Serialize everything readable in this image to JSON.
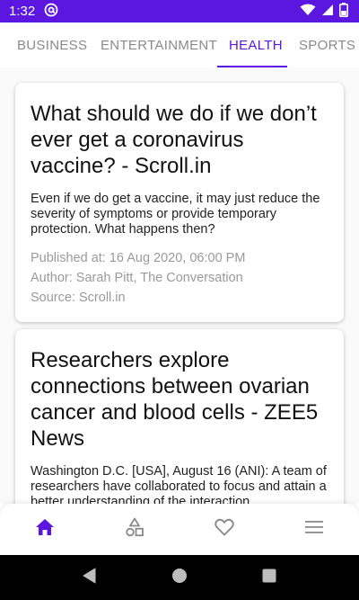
{
  "status_bar": {
    "time": "1:32",
    "icons": [
      "at-sign-icon",
      "wifi-icon",
      "signal-icon",
      "battery-icon"
    ]
  },
  "tabs": [
    {
      "label": "Business",
      "active": false
    },
    {
      "label": "Entertainment",
      "active": false
    },
    {
      "label": "Health",
      "active": true
    },
    {
      "label": "Sports",
      "active": false
    }
  ],
  "articles": [
    {
      "title": "What should we do if we don’t ever get a coronavirus vaccine? - Scroll.in",
      "description": "Even if we do get a vaccine, it may just reduce the severity of symptoms or provide temporary protection. What happens then?",
      "published": "Published at: 16 Aug 2020, 06:00 PM",
      "author": "Author: Sarah Pitt, The Conversation",
      "source": "Source: Scroll.in"
    },
    {
      "title": "Researchers explore connections between ovarian cancer and blood cells - ZEE5 News",
      "description": "Washington D.C. [USA], August 16 (ANI): A team of researchers have collaborated to focus and attain a better understanding of the interaction"
    }
  ],
  "bottom_nav": {
    "items": [
      {
        "icon": "home-icon",
        "active": true
      },
      {
        "icon": "categories-icon",
        "active": false
      },
      {
        "icon": "heart-icon",
        "active": false
      },
      {
        "icon": "menu-icon",
        "active": false
      }
    ]
  },
  "colors": {
    "primary": "#5b16e0",
    "inactive_tab": "#8a8a8a",
    "meta_text": "#9a9a9a"
  }
}
